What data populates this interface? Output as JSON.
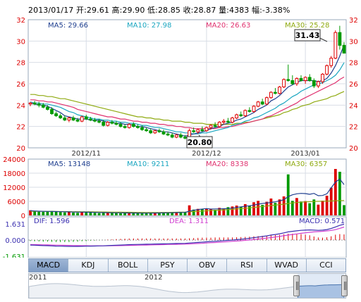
{
  "header": {
    "date": "2013/01/17",
    "open_label": "开:",
    "open": "29.61",
    "high_label": "高:",
    "high": "29.90",
    "low_label": "低:",
    "low": "28.85",
    "close_label": "收:",
    "close": "28.87",
    "vol_label": "量:",
    "vol": "4383",
    "chg_label": "幅:",
    "chg": "-3.38%"
  },
  "legend_main": {
    "ma5": "MA5: 29.66",
    "ma10": "MA10: 27.98",
    "ma20": "MA20: 26.63",
    "ma30": "MA30: 25.28"
  },
  "legend_vol": {
    "ma5": "MA5: 13148",
    "ma10": "MA10: 9211",
    "ma20": "MA20: 8338",
    "ma30": "MA30: 6357"
  },
  "legend_macd": {
    "dif": "DIF: 1.596",
    "dea": "DEA: 1.311",
    "macd": "MACD: 0.571"
  },
  "colors": {
    "up": "#dd0000",
    "down": "#009900",
    "ma5": "#1f3f8f",
    "ma10": "#1aa6c0",
    "ma20": "#e0306e",
    "ma30": "#8faa10",
    "grid": "#d8dde6",
    "border": "#9aa8bb",
    "dif": "#3a2fb0",
    "dea": "#d03fd0"
  },
  "annotations": {
    "max_label": "31.43",
    "min_label": "20.80"
  },
  "tabs": [
    "MACD",
    "KDJ",
    "BOLL",
    "PSY",
    "OBV",
    "RSI",
    "WVAD",
    "CCI"
  ],
  "active_tab": "MACD",
  "navigator": {
    "year1": "2011",
    "year2": "2012"
  },
  "chart_data": {
    "type": "candlestick",
    "price_axis": {
      "ticks": [
        20,
        22,
        24,
        26,
        28,
        30,
        32
      ],
      "ylim": [
        20,
        32
      ]
    },
    "x_labels": [
      {
        "label": "2012/11",
        "index": 13
      },
      {
        "label": "2012/12",
        "index": 41
      },
      {
        "label": "2013/01",
        "index": 64
      }
    ],
    "ohlc": [
      [
        24.1,
        24.3,
        23.9,
        24.2
      ],
      [
        24.2,
        24.4,
        24.0,
        24.1
      ],
      [
        24.1,
        24.3,
        23.8,
        24.0
      ],
      [
        24.0,
        24.2,
        23.7,
        23.8
      ],
      [
        23.8,
        24.0,
        23.5,
        23.6
      ],
      [
        23.6,
        23.8,
        23.1,
        23.2
      ],
      [
        23.2,
        23.4,
        22.9,
        23.0
      ],
      [
        23.0,
        23.2,
        22.7,
        22.8
      ],
      [
        22.8,
        23.0,
        22.5,
        22.6
      ],
      [
        22.6,
        22.9,
        22.4,
        22.8
      ],
      [
        22.8,
        23.0,
        22.5,
        22.6
      ],
      [
        22.6,
        22.8,
        22.4,
        22.5
      ],
      [
        22.5,
        23.0,
        22.4,
        22.9
      ],
      [
        22.9,
        23.1,
        22.6,
        22.7
      ],
      [
        22.7,
        22.9,
        22.5,
        22.6
      ],
      [
        22.6,
        22.8,
        22.4,
        22.5
      ],
      [
        22.5,
        22.7,
        22.3,
        22.4
      ],
      [
        22.4,
        22.6,
        22.0,
        22.1
      ],
      [
        22.1,
        22.5,
        22.0,
        22.4
      ],
      [
        22.4,
        22.6,
        22.2,
        22.3
      ],
      [
        22.3,
        22.5,
        22.1,
        22.2
      ],
      [
        22.2,
        22.4,
        21.9,
        22.0
      ],
      [
        22.0,
        22.2,
        21.8,
        21.9
      ],
      [
        21.9,
        22.3,
        21.8,
        22.2
      ],
      [
        22.2,
        22.4,
        21.9,
        22.0
      ],
      [
        22.0,
        22.2,
        21.8,
        21.9
      ],
      [
        21.9,
        22.1,
        21.6,
        21.7
      ],
      [
        21.7,
        21.9,
        21.5,
        21.6
      ],
      [
        21.6,
        21.8,
        21.3,
        21.4
      ],
      [
        21.4,
        21.7,
        21.3,
        21.6
      ],
      [
        21.6,
        21.8,
        21.4,
        21.5
      ],
      [
        21.5,
        21.7,
        21.2,
        21.3
      ],
      [
        21.3,
        21.5,
        21.1,
        21.2
      ],
      [
        21.2,
        21.4,
        20.9,
        21.0
      ],
      [
        21.0,
        21.3,
        20.9,
        21.2
      ],
      [
        21.2,
        21.4,
        20.9,
        21.0
      ],
      [
        21.0,
        21.2,
        20.8,
        20.9
      ],
      [
        20.9,
        21.8,
        20.8,
        21.6
      ],
      [
        21.6,
        21.9,
        21.4,
        21.5
      ],
      [
        21.5,
        21.8,
        21.3,
        21.7
      ],
      [
        21.7,
        22.0,
        21.5,
        21.6
      ],
      [
        21.6,
        22.0,
        21.5,
        21.9
      ],
      [
        21.9,
        22.2,
        21.7,
        22.1
      ],
      [
        22.1,
        22.4,
        21.9,
        22.0
      ],
      [
        22.0,
        22.5,
        21.9,
        22.4
      ],
      [
        22.4,
        22.7,
        22.2,
        22.5
      ],
      [
        22.5,
        22.8,
        22.3,
        22.4
      ],
      [
        22.4,
        22.9,
        22.3,
        22.8
      ],
      [
        22.8,
        23.2,
        22.7,
        23.1
      ],
      [
        23.1,
        23.4,
        22.9,
        23.0
      ],
      [
        23.0,
        23.6,
        22.9,
        23.5
      ],
      [
        23.5,
        23.8,
        23.3,
        23.4
      ],
      [
        23.4,
        24.0,
        23.3,
        23.9
      ],
      [
        23.9,
        24.4,
        23.8,
        24.3
      ],
      [
        24.3,
        24.6,
        24.0,
        24.1
      ],
      [
        24.1,
        24.8,
        24.0,
        24.7
      ],
      [
        24.7,
        25.3,
        24.6,
        25.2
      ],
      [
        25.2,
        25.6,
        25.0,
        25.1
      ],
      [
        25.1,
        25.8,
        25.0,
        25.7
      ],
      [
        25.7,
        26.5,
        25.6,
        26.4
      ],
      [
        26.4,
        27.8,
        26.2,
        26.3
      ],
      [
        26.3,
        26.8,
        25.9,
        26.0
      ],
      [
        26.0,
        26.6,
        25.8,
        26.5
      ],
      [
        26.5,
        26.8,
        26.2,
        26.3
      ],
      [
        26.3,
        26.7,
        26.0,
        26.6
      ],
      [
        26.6,
        26.9,
        26.2,
        26.3
      ],
      [
        26.3,
        26.5,
        25.6,
        25.8
      ],
      [
        25.8,
        26.3,
        25.6,
        26.2
      ],
      [
        26.2,
        27.0,
        26.0,
        26.9
      ],
      [
        26.9,
        27.8,
        26.8,
        27.7
      ],
      [
        27.7,
        28.6,
        27.5,
        28.4
      ],
      [
        28.4,
        31.0,
        28.3,
        30.8
      ],
      [
        30.8,
        31.43,
        29.2,
        29.6
      ],
      [
        29.6,
        29.9,
        28.85,
        28.87
      ]
    ],
    "ma5": [
      24.2,
      24.1,
      24.0,
      24.0,
      23.9,
      23.7,
      23.5,
      23.3,
      23.0,
      22.9,
      22.8,
      22.7,
      22.7,
      22.7,
      22.6,
      22.6,
      22.6,
      22.5,
      22.4,
      22.4,
      22.3,
      22.3,
      22.2,
      22.2,
      22.1,
      22.0,
      22.0,
      21.9,
      21.8,
      21.7,
      21.6,
      21.5,
      21.5,
      21.4,
      21.3,
      21.2,
      21.1,
      21.2,
      21.3,
      21.4,
      21.5,
      21.6,
      21.8,
      21.9,
      22.0,
      22.2,
      22.3,
      22.4,
      22.6,
      22.7,
      22.9,
      23.1,
      23.3,
      23.6,
      23.8,
      24.0,
      24.4,
      24.6,
      24.9,
      25.3,
      25.7,
      25.9,
      26.1,
      26.3,
      26.3,
      26.3,
      26.3,
      26.2,
      26.3,
      26.5,
      27.0,
      27.7,
      28.6,
      29.66
    ],
    "ma10": [
      24.3,
      24.2,
      24.2,
      24.1,
      24.1,
      24.0,
      23.9,
      23.8,
      23.6,
      23.4,
      23.3,
      23.1,
      23.0,
      22.9,
      22.8,
      22.7,
      22.7,
      22.6,
      22.6,
      22.5,
      22.5,
      22.4,
      22.4,
      22.3,
      22.3,
      22.2,
      22.1,
      22.1,
      22.0,
      21.9,
      21.9,
      21.8,
      21.7,
      21.6,
      21.5,
      21.5,
      21.4,
      21.4,
      21.3,
      21.3,
      21.4,
      21.4,
      21.5,
      21.6,
      21.7,
      21.8,
      21.9,
      22.1,
      22.2,
      22.3,
      22.5,
      22.6,
      22.8,
      22.9,
      23.1,
      23.3,
      23.5,
      23.7,
      24.0,
      24.2,
      24.5,
      24.8,
      25.0,
      25.3,
      25.5,
      25.7,
      25.9,
      26.0,
      26.1,
      26.3,
      26.5,
      26.8,
      27.3,
      27.98
    ],
    "ma20": [
      24.5,
      24.5,
      24.4,
      24.4,
      24.3,
      24.3,
      24.2,
      24.1,
      24.0,
      23.9,
      23.8,
      23.6,
      23.5,
      23.4,
      23.3,
      23.2,
      23.1,
      23.0,
      22.9,
      22.9,
      22.8,
      22.7,
      22.7,
      22.6,
      22.5,
      22.5,
      22.4,
      22.4,
      22.3,
      22.3,
      22.2,
      22.2,
      22.1,
      22.1,
      22.0,
      22.0,
      21.9,
      21.9,
      21.8,
      21.8,
      21.8,
      21.8,
      21.8,
      21.8,
      21.9,
      21.9,
      22.0,
      22.0,
      22.1,
      22.2,
      22.3,
      22.4,
      22.5,
      22.6,
      22.7,
      22.9,
      23.0,
      23.2,
      23.4,
      23.6,
      23.8,
      24.0,
      24.2,
      24.5,
      24.7,
      24.9,
      25.1,
      25.3,
      25.5,
      25.7,
      25.9,
      26.1,
      26.4,
      26.63
    ],
    "ma30": [
      25.0,
      25.0,
      24.9,
      24.9,
      24.8,
      24.8,
      24.7,
      24.6,
      24.6,
      24.5,
      24.4,
      24.3,
      24.2,
      24.1,
      24.0,
      23.9,
      23.8,
      23.7,
      23.6,
      23.5,
      23.4,
      23.3,
      23.2,
      23.1,
      23.0,
      22.9,
      22.9,
      22.8,
      22.8,
      22.7,
      22.7,
      22.6,
      22.6,
      22.5,
      22.5,
      22.5,
      22.4,
      22.4,
      22.3,
      22.3,
      22.3,
      22.2,
      22.2,
      22.2,
      22.2,
      22.2,
      22.2,
      22.2,
      22.3,
      22.3,
      22.4,
      22.4,
      22.5,
      22.6,
      22.7,
      22.8,
      22.9,
      23.0,
      23.1,
      23.3,
      23.4,
      23.6,
      23.7,
      23.9,
      24.0,
      24.1,
      24.3,
      24.4,
      24.5,
      24.6,
      24.8,
      24.9,
      25.1,
      25.28
    ],
    "volume_axis": {
      "ticks": [
        0,
        6000,
        12000,
        18000,
        24000
      ],
      "ylim": [
        0,
        24000
      ]
    },
    "volume": [
      2200,
      1800,
      1600,
      1500,
      1700,
      1900,
      1500,
      1400,
      1300,
      1500,
      1200,
      1100,
      1600,
      1300,
      1200,
      1100,
      1000,
      1200,
      1300,
      1100,
      1000,
      900,
      1100,
      1200,
      1000,
      900,
      1000,
      900,
      1100,
      1300,
      1000,
      1200,
      1100,
      1300,
      1400,
      1200,
      1500,
      4300,
      2500,
      2800,
      2600,
      3000,
      2700,
      2400,
      3200,
      2900,
      3500,
      3800,
      4200,
      3600,
      4800,
      4100,
      5600,
      6200,
      4500,
      5800,
      7200,
      5400,
      6800,
      8100,
      17500,
      6200,
      7400,
      5900,
      6100,
      5200,
      6800,
      4600,
      6300,
      8400,
      11800,
      19800,
      18600,
      4383
    ],
    "vol_ma5": [
      2000,
      1900,
      1800,
      1750,
      1720,
      1700,
      1650,
      1600,
      1550,
      1500,
      1450,
      1400,
      1400,
      1380,
      1350,
      1300,
      1250,
      1200,
      1180,
      1150,
      1120,
      1100,
      1080,
      1060,
      1040,
      1020,
      1000,
      990,
      1000,
      1020,
      1050,
      1080,
      1100,
      1150,
      1200,
      1250,
      1300,
      1800,
      2200,
      2500,
      2700,
      2900,
      2700,
      2750,
      2800,
      2850,
      2950,
      3100,
      3400,
      3650,
      3900,
      4100,
      4400,
      4800,
      5100,
      5300,
      5500,
      5800,
      6200,
      6700,
      8000,
      8800,
      9200,
      9400,
      9300,
      9000,
      9400,
      8400,
      8500,
      9200,
      11800,
      14200,
      15500,
      13148
    ],
    "vol_ma30": [
      1800,
      1780,
      1760,
      1740,
      1720,
      1700,
      1680,
      1660,
      1640,
      1620,
      1600,
      1580,
      1560,
      1540,
      1520,
      1500,
      1480,
      1460,
      1440,
      1420,
      1400,
      1380,
      1360,
      1340,
      1320,
      1300,
      1280,
      1270,
      1260,
      1260,
      1270,
      1280,
      1300,
      1330,
      1360,
      1400,
      1450,
      1550,
      1650,
      1750,
      1850,
      1950,
      2050,
      2150,
      2250,
      2350,
      2450,
      2600,
      2750,
      2900,
      3050,
      3200,
      3400,
      3600,
      3800,
      4000,
      4200,
      4400,
      4600,
      4800,
      5100,
      5300,
      5500,
      5650,
      5750,
      5850,
      5950,
      6000,
      6050,
      6100,
      6150,
      6250,
      6300,
      6357
    ],
    "macd_axis": {
      "ticks": [
        1.631,
        0.0,
        -1.631
      ],
      "ylim": [
        -1.631,
        1.631
      ]
    },
    "dif": [
      -0.5,
      -0.52,
      -0.54,
      -0.56,
      -0.57,
      -0.59,
      -0.61,
      -0.62,
      -0.63,
      -0.64,
      -0.64,
      -0.64,
      -0.63,
      -0.62,
      -0.61,
      -0.6,
      -0.59,
      -0.58,
      -0.56,
      -0.54,
      -0.52,
      -0.5,
      -0.48,
      -0.46,
      -0.45,
      -0.44,
      -0.43,
      -0.42,
      -0.41,
      -0.4,
      -0.39,
      -0.38,
      -0.37,
      -0.36,
      -0.35,
      -0.34,
      -0.33,
      -0.3,
      -0.27,
      -0.24,
      -0.21,
      -0.18,
      -0.15,
      -0.12,
      -0.09,
      -0.06,
      -0.03,
      0.0,
      0.04,
      0.08,
      0.13,
      0.18,
      0.24,
      0.3,
      0.36,
      0.42,
      0.5,
      0.56,
      0.63,
      0.72,
      0.82,
      0.88,
      0.93,
      0.98,
      1.0,
      1.02,
      1.0,
      0.98,
      1.0,
      1.06,
      1.16,
      1.32,
      1.48,
      1.596
    ],
    "dea": [
      -0.45,
      -0.46,
      -0.47,
      -0.48,
      -0.49,
      -0.5,
      -0.51,
      -0.52,
      -0.53,
      -0.54,
      -0.55,
      -0.56,
      -0.57,
      -0.57,
      -0.58,
      -0.58,
      -0.58,
      -0.58,
      -0.58,
      -0.57,
      -0.57,
      -0.56,
      -0.55,
      -0.54,
      -0.53,
      -0.52,
      -0.51,
      -0.5,
      -0.49,
      -0.48,
      -0.47,
      -0.46,
      -0.45,
      -0.44,
      -0.43,
      -0.42,
      -0.41,
      -0.39,
      -0.37,
      -0.35,
      -0.33,
      -0.3,
      -0.27,
      -0.25,
      -0.22,
      -0.19,
      -0.16,
      -0.13,
      -0.1,
      -0.07,
      -0.03,
      0.01,
      0.05,
      0.1,
      0.15,
      0.2,
      0.25,
      0.31,
      0.37,
      0.43,
      0.5,
      0.56,
      0.62,
      0.68,
      0.73,
      0.78,
      0.82,
      0.85,
      0.88,
      0.92,
      0.97,
      1.05,
      1.18,
      1.311
    ]
  }
}
